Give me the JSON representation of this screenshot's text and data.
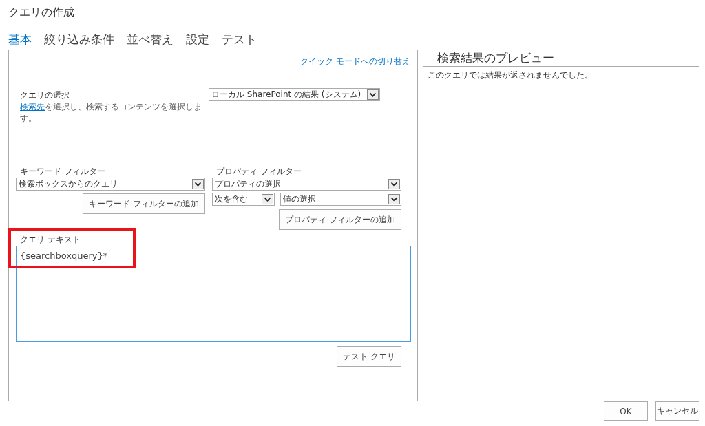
{
  "title": "クエリの作成",
  "tabs": [
    {
      "label": "基本",
      "selected": true
    },
    {
      "label": "絞り込み条件",
      "selected": false
    },
    {
      "label": "並べ替え",
      "selected": false
    },
    {
      "label": "設定",
      "selected": false
    },
    {
      "label": "テスト",
      "selected": false
    }
  ],
  "switch_link": "クイック モードへの切り替え",
  "query_select": {
    "label": "クエリの選択",
    "help_link": "検索先",
    "help_text": "を選択し、検索するコンテンツを選択します。",
    "value": "ローカル SharePoint の結果 (システム)"
  },
  "keyword_filter": {
    "label": "キーワード フィルター",
    "value": "検索ボックスからのクエリ",
    "button": "キーワード フィルターの追加"
  },
  "property_filter": {
    "label": "プロパティ フィルター",
    "property": "プロパティの選択",
    "operator": "次を含む",
    "value": "値の選択",
    "button": "プロパティ フィルターの追加"
  },
  "query_text": {
    "label": "クエリ テキスト",
    "value": "{searchboxquery}*",
    "highlighted": true
  },
  "test_button": "テスト クエリ",
  "preview": {
    "title": "検索結果のプレビュー",
    "message": "このクエリでは結果が返されませんでした。"
  },
  "buttons": [
    "OK",
    "キャンセル"
  ]
}
